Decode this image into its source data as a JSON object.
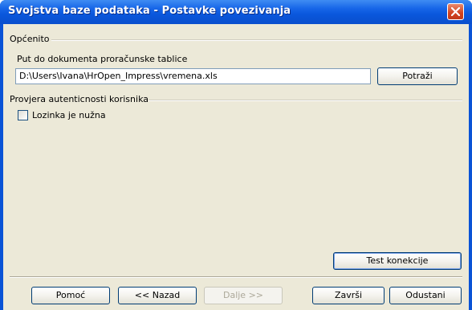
{
  "window": {
    "title": "Svojstva baze podataka - Postavke povezivanja"
  },
  "general": {
    "heading": "Općenito",
    "path_label": "Put do dokumenta proračunske tablice",
    "path_value": "D:\\Users\\Ivana\\HrOpen_Impress\\vremena.xls",
    "browse_label": "Potraži"
  },
  "auth": {
    "heading": "Provjera autenticnosti korisnika",
    "password_required_label": "Lozinka je nužna",
    "password_required_checked": false
  },
  "test_connection_label": "Test konekcije",
  "footer": {
    "help_label": "Pomoć",
    "back_label": "<< Nazad",
    "next_label": "Dalje >>",
    "finish_label": "Završi",
    "cancel_label": "Odustani"
  },
  "colors": {
    "titlebar": "#0a53d6",
    "close_button": "#d1421f",
    "dialog_background": "#ece9d8"
  },
  "icons": {
    "close": "close-icon"
  }
}
